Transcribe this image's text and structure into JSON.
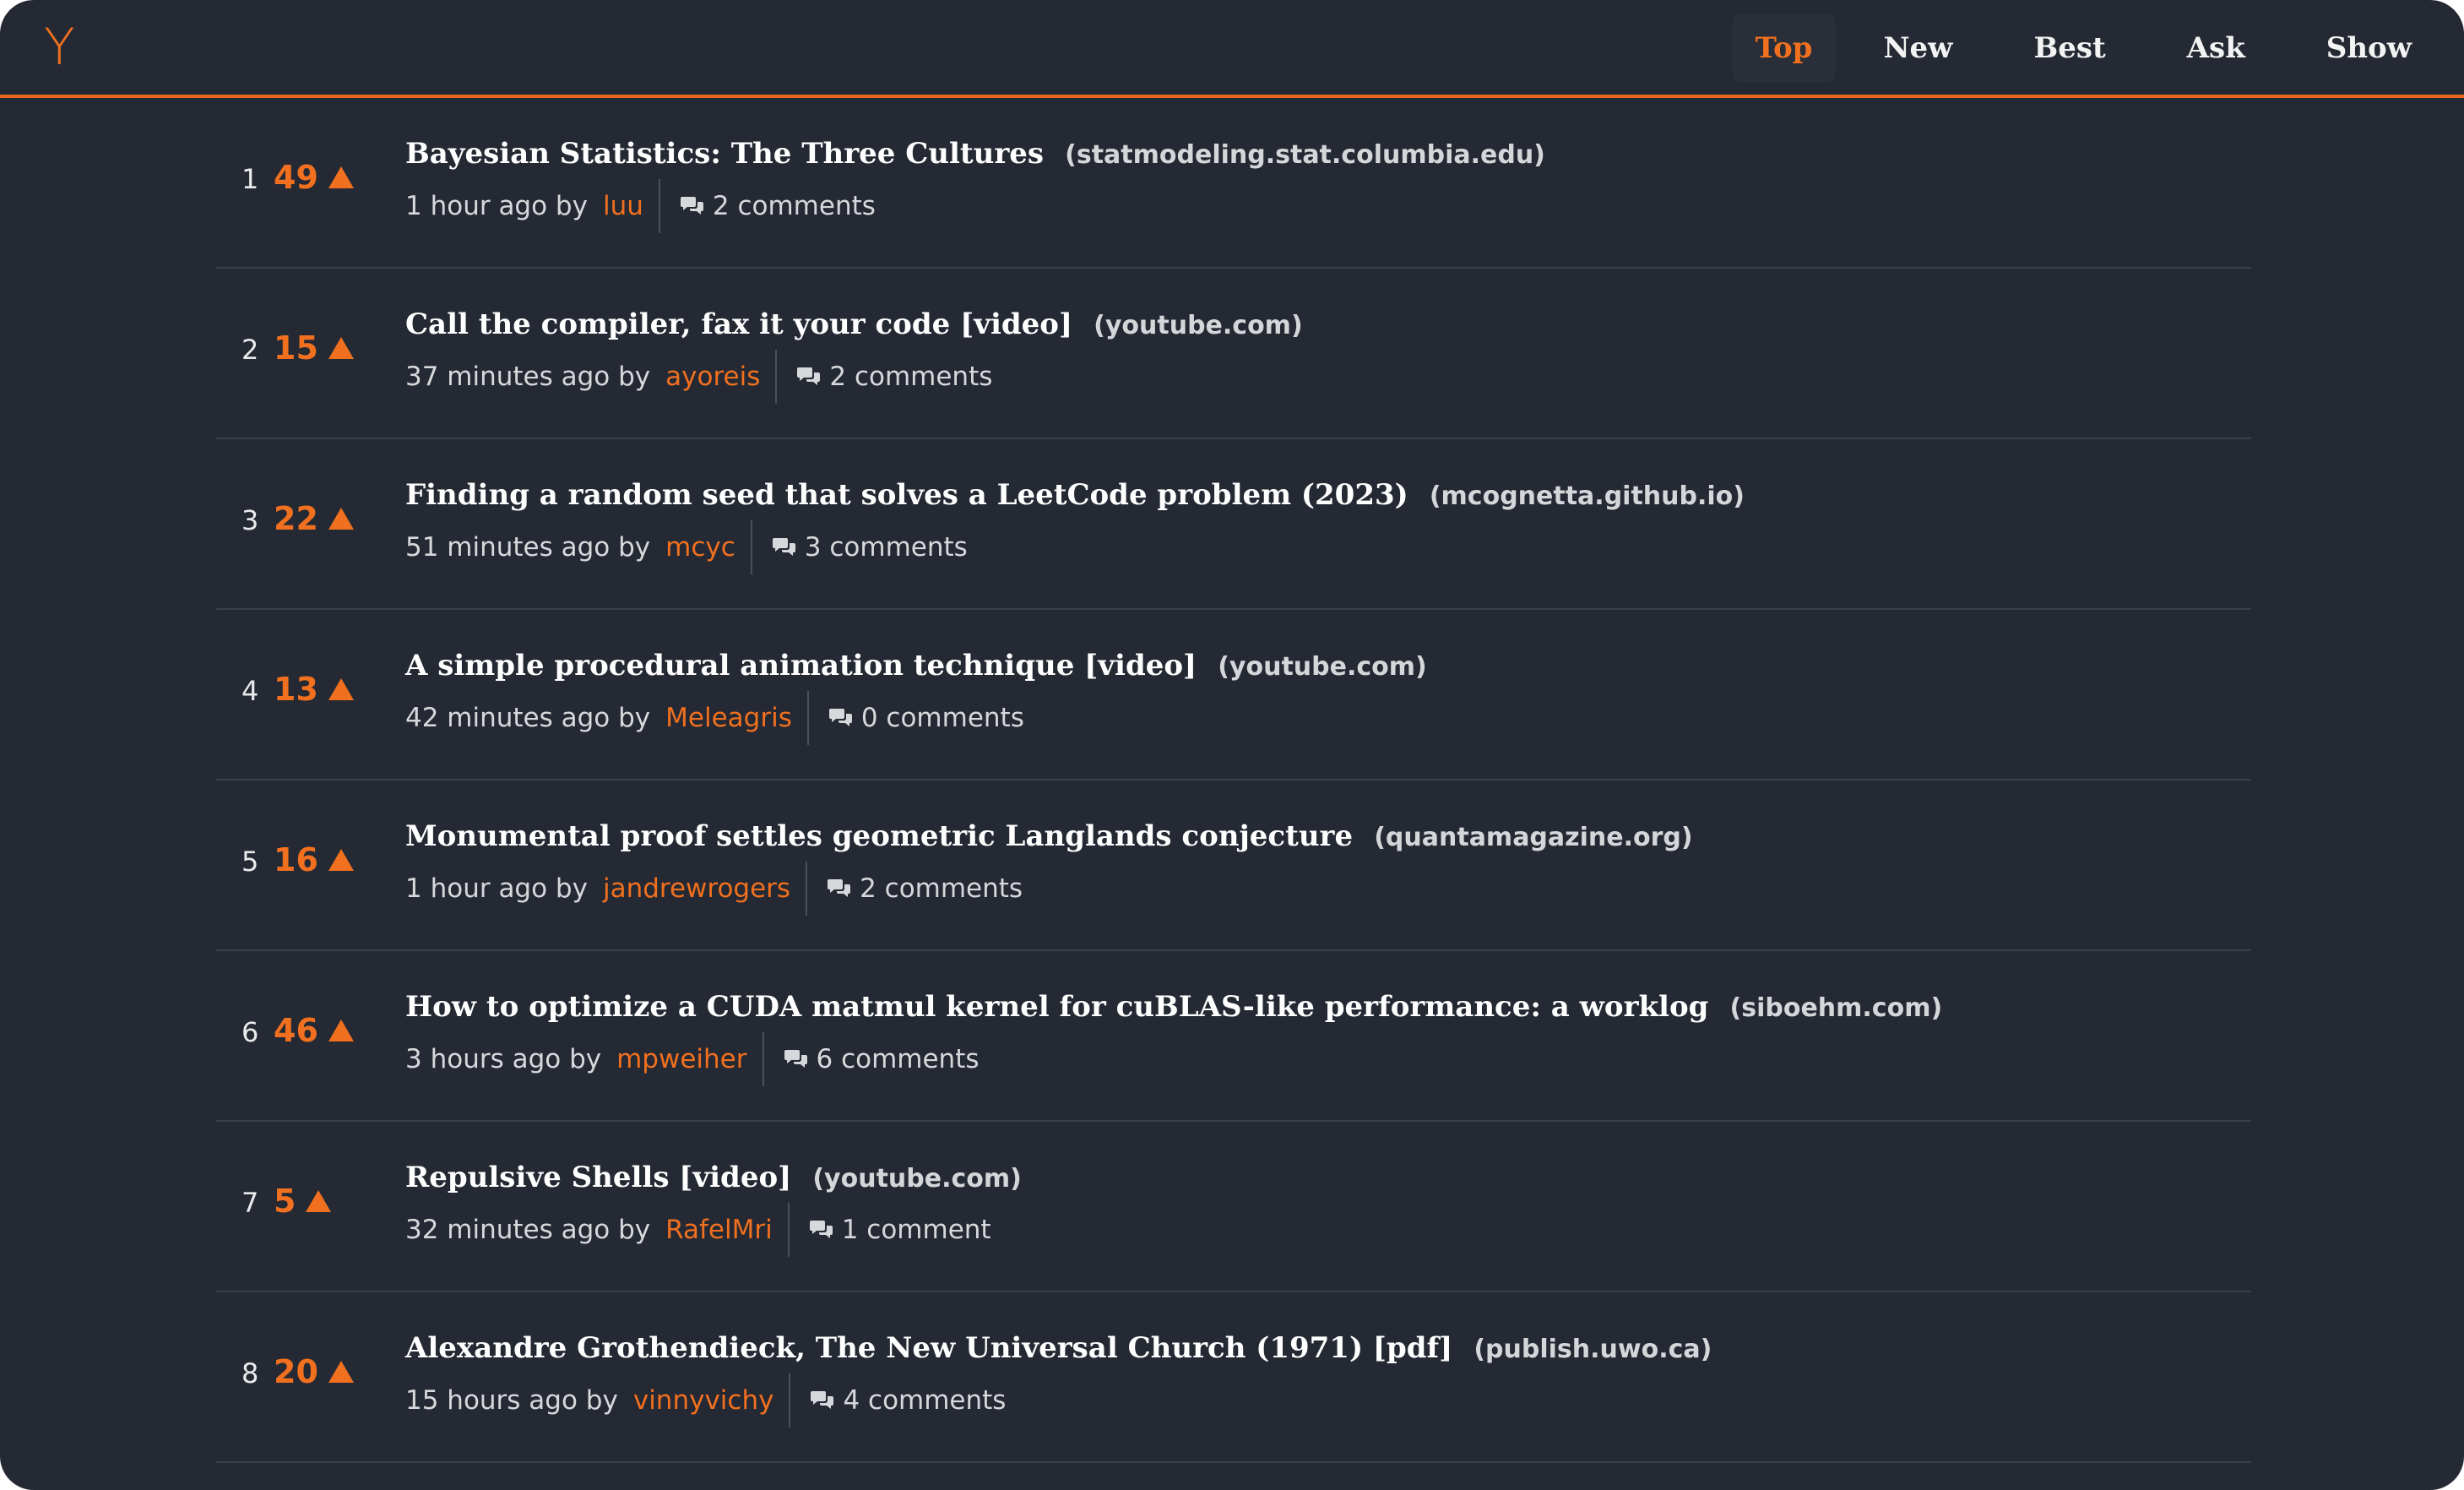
{
  "logo": "Y",
  "nav": {
    "tabs": [
      "Top",
      "New",
      "Best",
      "Ask",
      "Show"
    ],
    "active": "Top"
  },
  "colors": {
    "background": "#242933",
    "accent": "#f0701f",
    "divider": "#3a3f4a",
    "text": "#ffffff"
  },
  "icons": {
    "upvote": "triangle-up-icon",
    "comments": "chat-bubbles-icon"
  },
  "stories": [
    {
      "rank": "1",
      "score": "49",
      "title": "Bayesian Statistics: The Three Cultures",
      "domain": "(statmodeling.stat.columbia.edu)",
      "time": "1 hour ago by",
      "author": "luu",
      "comments": "2 comments"
    },
    {
      "rank": "2",
      "score": "15",
      "title": "Call the compiler, fax it your code [video]",
      "domain": "(youtube.com)",
      "time": "37 minutes ago by",
      "author": "ayoreis",
      "comments": "2 comments"
    },
    {
      "rank": "3",
      "score": "22",
      "title": "Finding a random seed that solves a LeetCode problem (2023)",
      "domain": "(mcognetta.github.io)",
      "time": "51 minutes ago by",
      "author": "mcyc",
      "comments": "3 comments"
    },
    {
      "rank": "4",
      "score": "13",
      "title": "A simple procedural animation technique [video]",
      "domain": "(youtube.com)",
      "time": "42 minutes ago by",
      "author": "Meleagris",
      "comments": "0 comments"
    },
    {
      "rank": "5",
      "score": "16",
      "title": "Monumental proof settles geometric Langlands conjecture",
      "domain": "(quantamagazine.org)",
      "time": "1 hour ago by",
      "author": "jandrewrogers",
      "comments": "2 comments"
    },
    {
      "rank": "6",
      "score": "46",
      "title": "How to optimize a CUDA matmul kernel for cuBLAS-like performance: a worklog",
      "domain": "(siboehm.com)",
      "time": "3 hours ago by",
      "author": "mpweiher",
      "comments": "6 comments"
    },
    {
      "rank": "7",
      "score": "5",
      "title": "Repulsive Shells [video]",
      "domain": "(youtube.com)",
      "time": "32 minutes ago by",
      "author": "RafelMri",
      "comments": "1 comment"
    },
    {
      "rank": "8",
      "score": "20",
      "title": "Alexandre Grothendieck, The New Universal Church (1971) [pdf]",
      "domain": "(publish.uwo.ca)",
      "time": "15 hours ago by",
      "author": "vinnyvichy",
      "comments": "4 comments"
    }
  ]
}
